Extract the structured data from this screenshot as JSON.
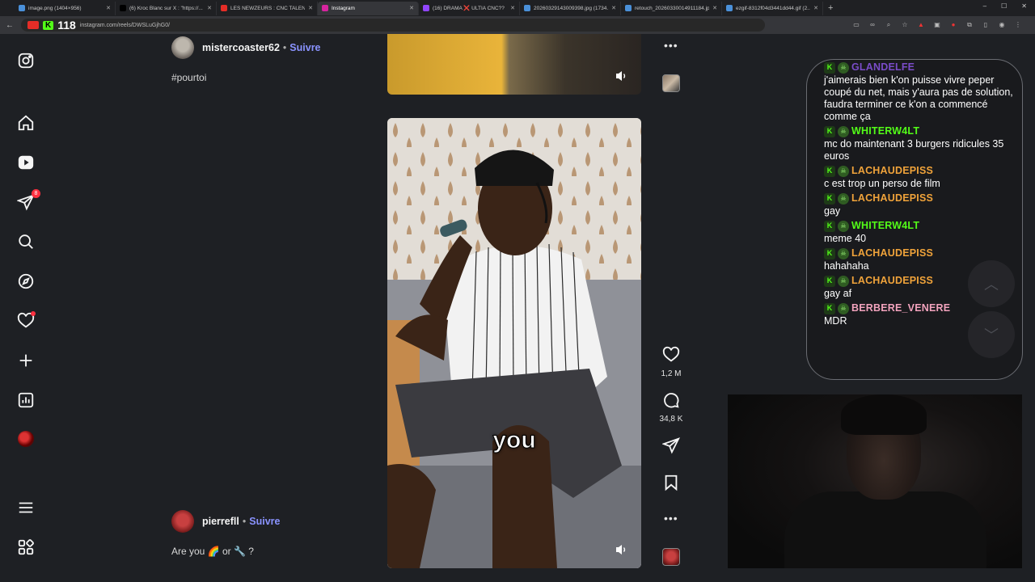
{
  "browser": {
    "tabs": [
      {
        "title": "image.png (1404×956)",
        "fav": "#4a90d9",
        "active": false
      },
      {
        "title": "(6) Kroc Blanc sur X : \"https://...",
        "fav": "#000000",
        "active": false
      },
      {
        "title": "LES NEWZEURS : CNC TALENT...",
        "fav": "#e52d27",
        "active": false
      },
      {
        "title": "Instagram",
        "fav": "#d6249f",
        "active": true
      },
      {
        "title": "(16) DRAMA ❌ ULTIA CNC??",
        "fav": "#9146ff",
        "active": false
      },
      {
        "title": "20260329143009398.jpg (1734...",
        "fav": "#4a90d9",
        "active": false
      },
      {
        "title": "retouch_20260330014911184.jp",
        "fav": "#4a90d9",
        "active": false
      },
      {
        "title": "ezgif-8312f04d3441dd44.gif (2...",
        "fav": "#4a90d9",
        "active": false
      }
    ],
    "new_tab": "+",
    "url": "instagram.com/reels/DWSLuGjhG0/",
    "kick_logo": "K",
    "kick_count": "118"
  },
  "sidebar": {
    "notifications_badge": "8"
  },
  "posts": {
    "top": {
      "username": "mistercoaster62",
      "separator": "•",
      "follow": "Suivre",
      "caption": "#pourtoi"
    },
    "bottom": {
      "username": "pierrefll",
      "separator": "•",
      "follow": "Suivre",
      "caption": "Are you 🌈 or 🔧 ?"
    }
  },
  "video": {
    "subtitle": "you"
  },
  "actions": {
    "likes": "1,2 M",
    "comments": "34,8 K",
    "more": "•••"
  },
  "chat": {
    "messages": [
      {
        "user": "GLANDELFE",
        "color": "#7a4cc9",
        "text": "j'aimerais bien k'on puisse vivre peper coupé du net, mais y'aura pas de solution, faudra terminer ce k'on a commencé comme ça"
      },
      {
        "user": "WHITERW4LT",
        "color": "#53fc18",
        "text": "mc do maintenant 3 burgers ridicules 35 euros"
      },
      {
        "user": "LACHAUDEPISS",
        "color": "#f0a33a",
        "text": "c est trop un perso de film"
      },
      {
        "user": "LACHAUDEPISS",
        "color": "#f0a33a",
        "text": "gay"
      },
      {
        "user": "WHITERW4LT",
        "color": "#53fc18",
        "text": "meme 40"
      },
      {
        "user": "LACHAUDEPISS",
        "color": "#f0a33a",
        "text": "hahahaha"
      },
      {
        "user": "LACHAUDEPISS",
        "color": "#f0a33a",
        "text": "gay af"
      },
      {
        "user": "BERBERE_VENERE",
        "color": "#f2a3bd",
        "text": "MDR"
      }
    ]
  },
  "colors": {
    "page_bg": "#1e2024",
    "follow": "#8a93ff",
    "kick_green": "#53fc18"
  }
}
